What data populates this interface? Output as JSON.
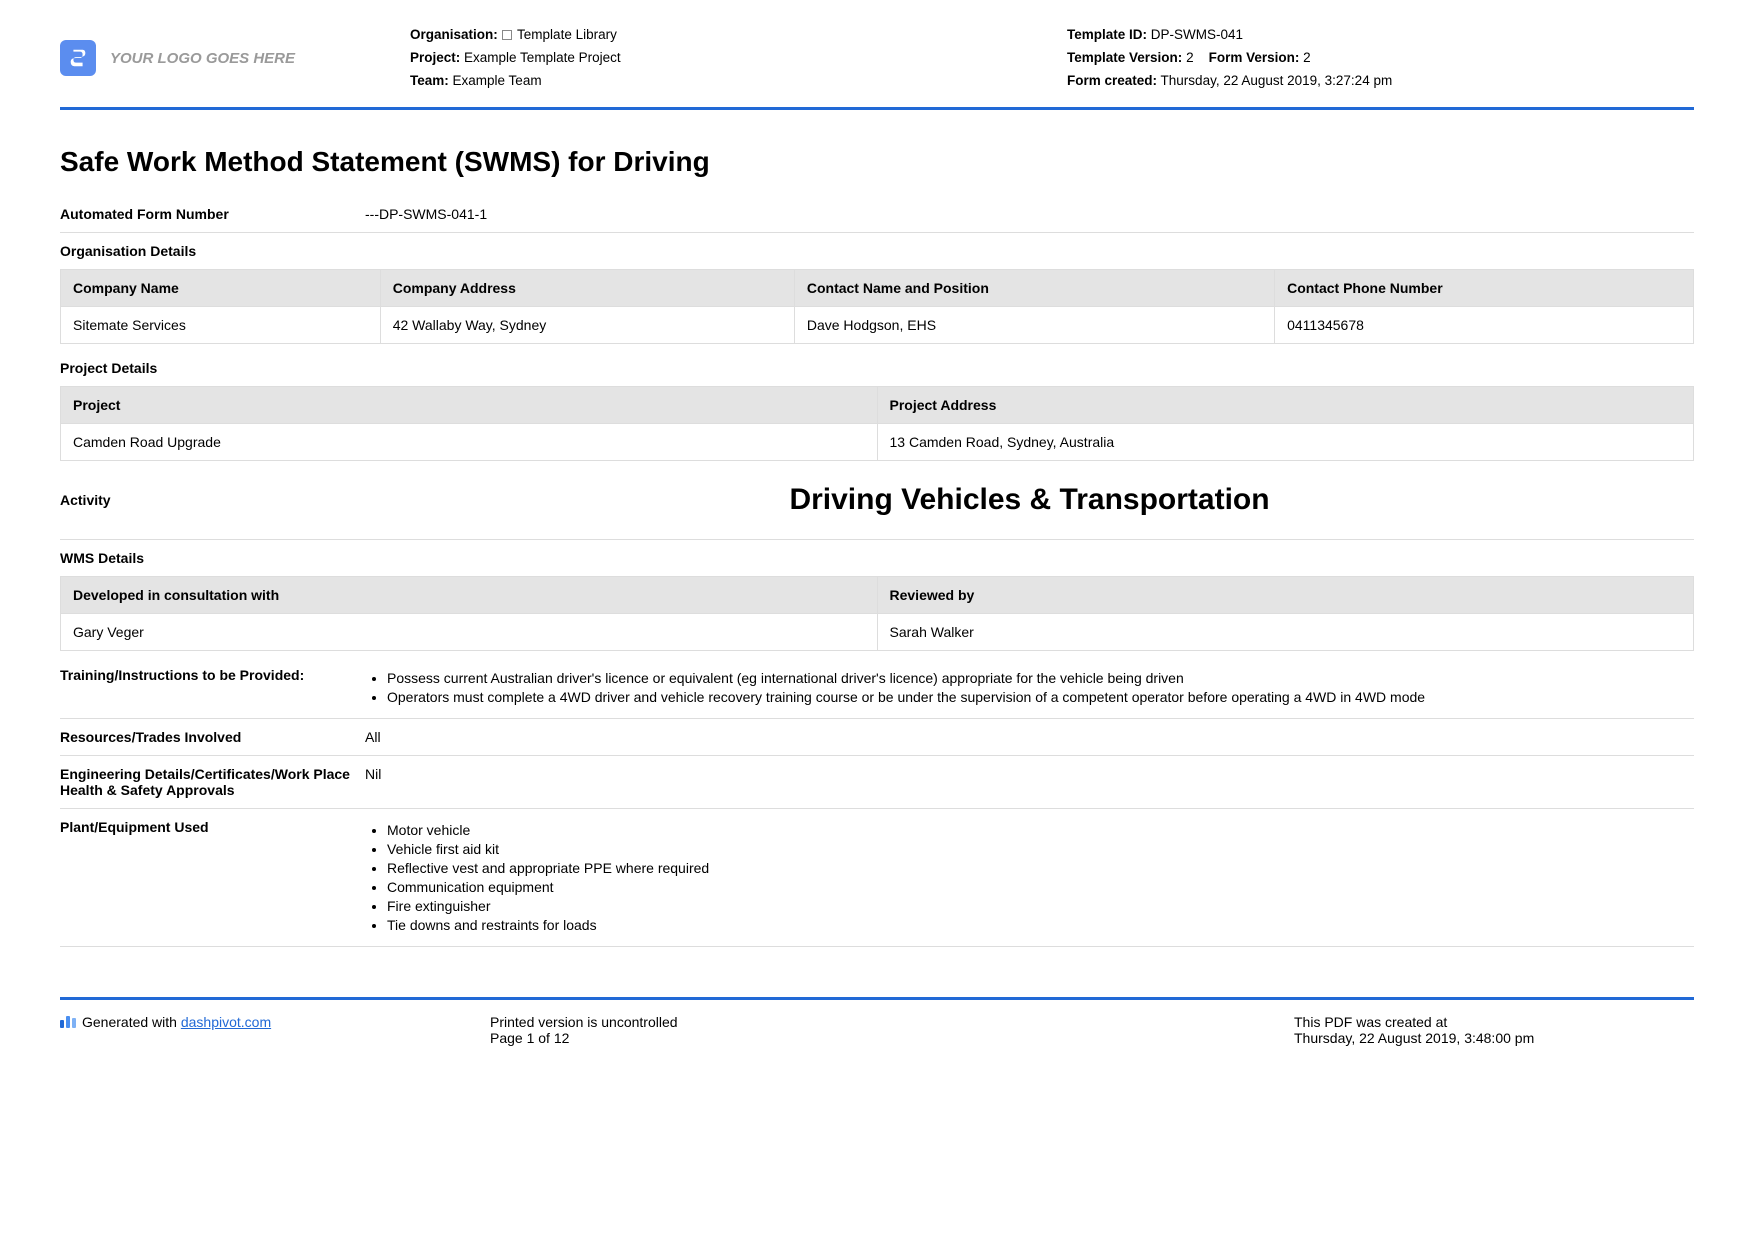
{
  "logo_placeholder": "YOUR LOGO GOES HERE",
  "header_left": {
    "org_label": "Organisation:",
    "org_value": "Template Library",
    "project_label": "Project:",
    "project_value": "Example Template Project",
    "team_label": "Team:",
    "team_value": "Example Team"
  },
  "header_right": {
    "tid_label": "Template ID:",
    "tid_value": "DP-SWMS-041",
    "tver_label": "Template Version:",
    "tver_value": "2",
    "fver_label": "Form Version:",
    "fver_value": "2",
    "fcreated_label": "Form created:",
    "fcreated_value": "Thursday, 22 August 2019, 3:27:24 pm"
  },
  "title": "Safe Work Method Statement (SWMS) for Driving",
  "autonum_label": "Automated Form Number",
  "autonum_value": "---DP-SWMS-041-1",
  "org_details_label": "Organisation Details",
  "org_table": {
    "h1": "Company Name",
    "h2": "Company Address",
    "h3": "Contact Name and Position",
    "h4": "Contact Phone Number",
    "c1": "Sitemate Services",
    "c2": "42 Wallaby Way, Sydney",
    "c3": "Dave Hodgson, EHS",
    "c4": "0411345678"
  },
  "proj_details_label": "Project Details",
  "proj_table": {
    "h1": "Project",
    "h2": "Project Address",
    "c1": "Camden Road Upgrade",
    "c2": "13 Camden Road, Sydney, Australia"
  },
  "activity_label": "Activity",
  "activity_value": "Driving Vehicles & Transportation",
  "wms_label": "WMS Details",
  "wms_table": {
    "h1": "Developed in consultation with",
    "h2": "Reviewed by",
    "c1": "Gary Veger",
    "c2": "Sarah Walker"
  },
  "training_label": "Training/Instructions to be Provided:",
  "training_items": [
    "Possess current Australian driver's licence or equivalent (eg international driver's licence) appropriate for the vehicle being driven",
    "Operators must complete a 4WD driver and vehicle recovery training course or be under the supervision of a competent operator before operating a 4WD in 4WD mode"
  ],
  "resources_label": "Resources/Trades Involved",
  "resources_value": "All",
  "eng_label": "Engineering Details/Certificates/Work Place Health & Safety Approvals",
  "eng_value": "Nil",
  "plant_label": "Plant/Equipment Used",
  "plant_items": [
    "Motor vehicle",
    "Vehicle first aid kit",
    "Reflective vest and appropriate PPE where required",
    "Communication equipment",
    "Fire extinguisher",
    "Tie downs and restraints for loads"
  ],
  "footer": {
    "gen_prefix": "Generated with ",
    "gen_link": "dashpivot.com",
    "uncontrolled": "Printed version is uncontrolled",
    "page": "Page 1 of 12",
    "created_label": "This PDF was created at",
    "created_value": "Thursday, 22 August 2019, 3:48:00 pm"
  }
}
